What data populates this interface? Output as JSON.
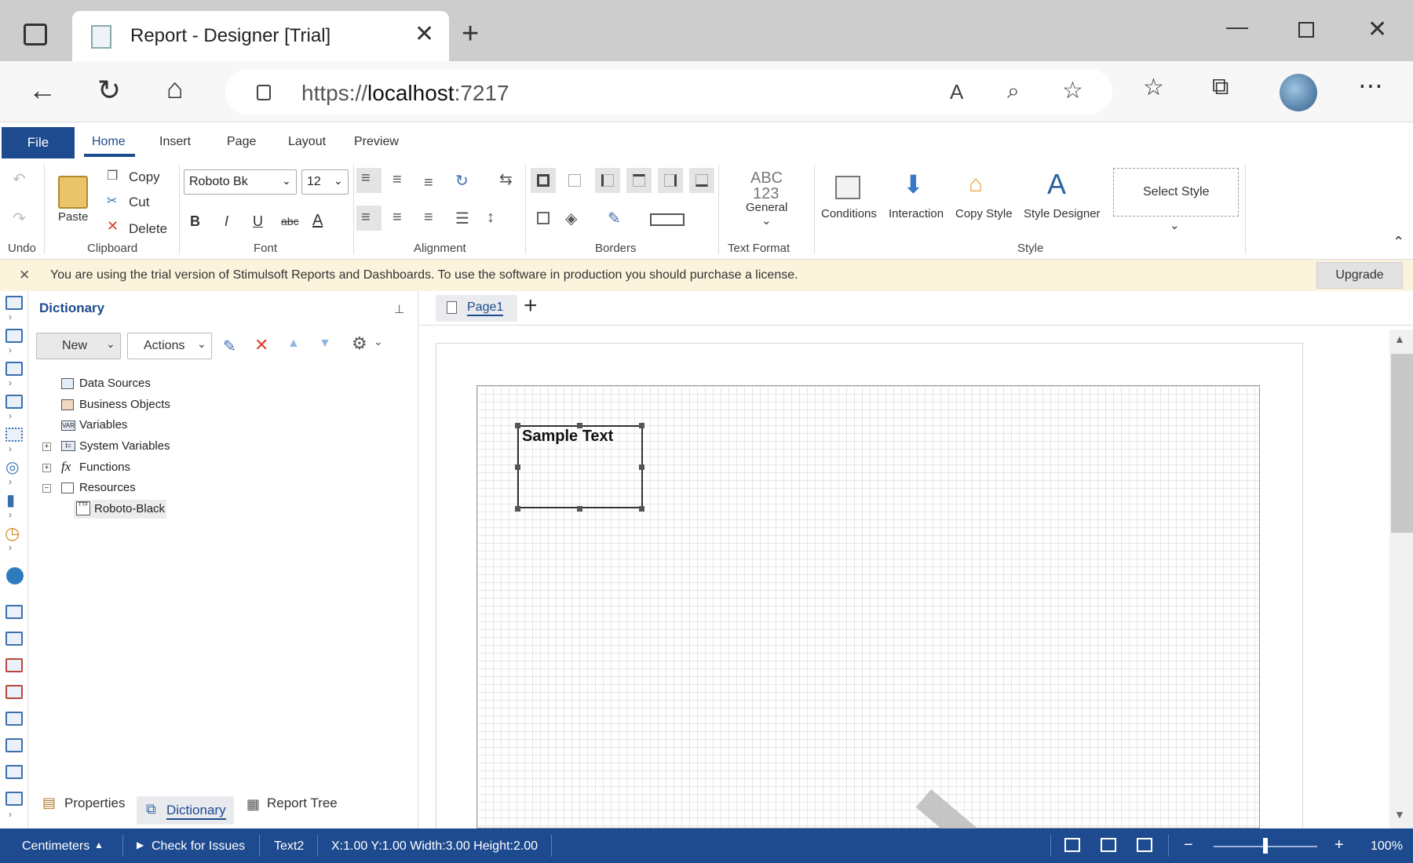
{
  "browser": {
    "tab_title": "Report - Designer [Trial]",
    "url_scheme": "https://",
    "url_host": "localhost",
    "url_port": ":7217"
  },
  "ribbon_tabs": [
    "File",
    "Home",
    "Insert",
    "Page",
    "Layout",
    "Preview"
  ],
  "ribbon": {
    "undo_label": "Undo",
    "clipboard": {
      "paste": "Paste",
      "copy": "Copy",
      "cut": "Cut",
      "delete": "Delete",
      "group": "Clipboard"
    },
    "font": {
      "family": "Roboto Bk",
      "size": "12",
      "group": "Font",
      "bold": "B",
      "italic": "I",
      "underline": "U",
      "strike": "abc",
      "color": "A"
    },
    "alignment_group": "Alignment",
    "borders_group": "Borders",
    "text_format": {
      "abc": "ABC",
      "nums": "123",
      "general": "General",
      "group": "Text Format"
    },
    "style": {
      "conditions": "Conditions",
      "interaction": "Interaction",
      "copy_style": "Copy Style",
      "style_designer": "Style Designer",
      "select_style": "Select Style",
      "group": "Style"
    }
  },
  "trial_banner": {
    "message": "You are using the trial version of Stimulsoft Reports and Dashboards. To use the software in production you should purchase a license.",
    "upgrade": "Upgrade"
  },
  "dictionary": {
    "title": "Dictionary",
    "new_btn": "New",
    "actions_btn": "Actions",
    "tree": [
      "Data Sources",
      "Business Objects",
      "Variables",
      "System Variables",
      "Functions",
      "Resources"
    ],
    "resource_child": "Roboto-Black",
    "var_icon": "VAR",
    "sys_icon": "I=",
    "fx_icon": "fx",
    "ttf_icon": "TTF"
  },
  "bottom_tabs": [
    "Properties",
    "Dictionary",
    "Report Tree"
  ],
  "page": {
    "tab": "Page1",
    "component_text": "Sample Text"
  },
  "status": {
    "units": "Centimeters",
    "check": "Check for Issues",
    "component": "Text2",
    "geometry": "X:1.00 Y:1.00 Width:3.00 Height:2.00",
    "zoom": "100%",
    "zoom_fraction": 0.5
  },
  "colors": {
    "accent": "#1e4b8f",
    "banner": "#fbf3dc"
  }
}
